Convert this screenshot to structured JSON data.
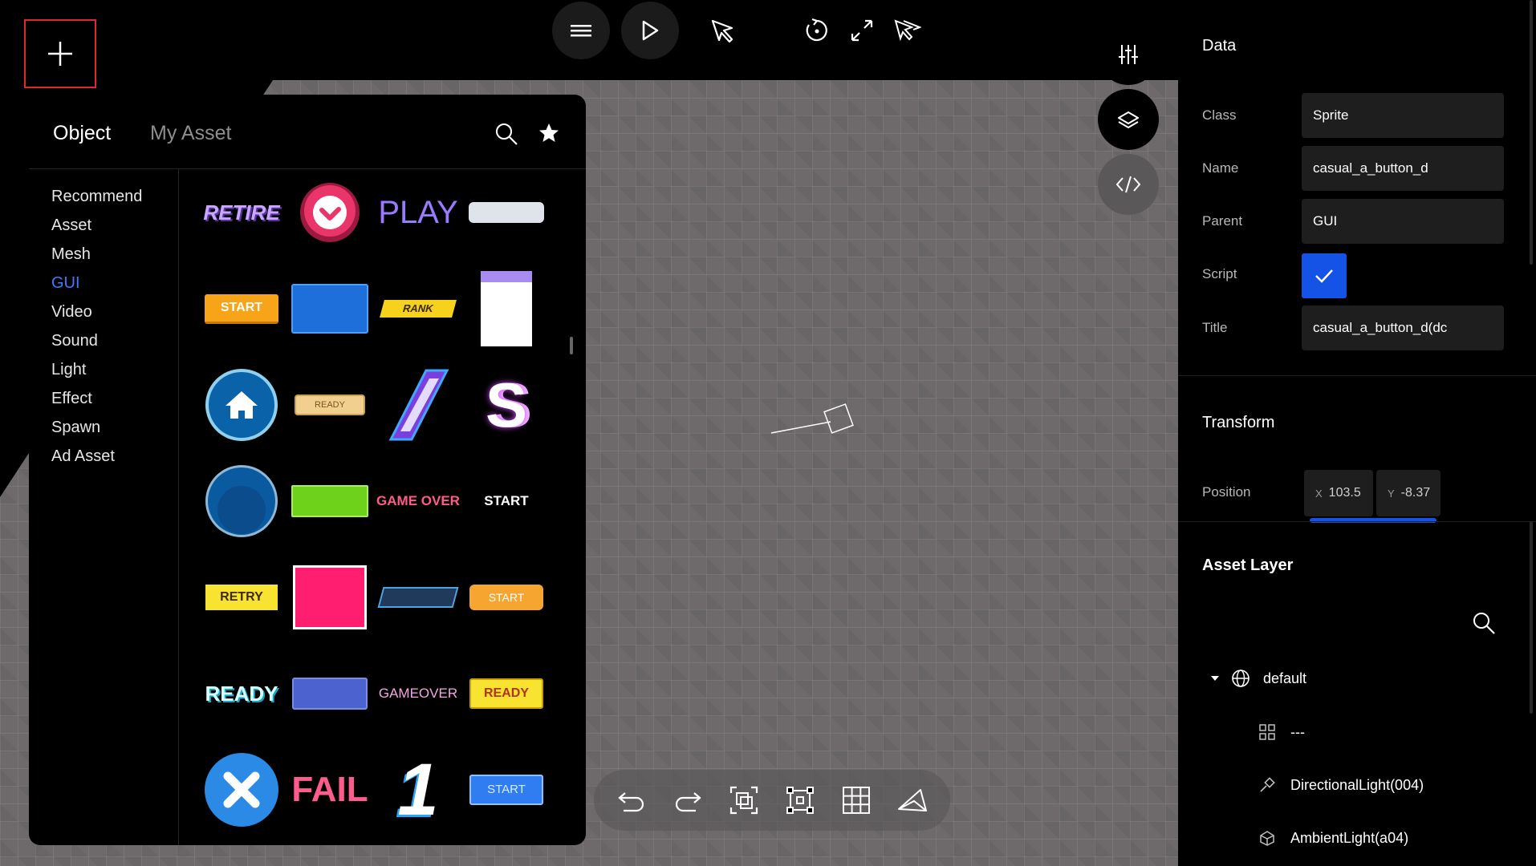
{
  "toolbar": {
    "add_icon": "plus-icon",
    "icons": [
      "menu-icon",
      "play-icon",
      "select-pointer-icon",
      "rotate-icon",
      "expand-icon",
      "multi-select-pointer-icon"
    ]
  },
  "side_tools": [
    "sliders-icon",
    "layers-icon",
    "code-icon"
  ],
  "asset_panel": {
    "tabs": [
      "Object",
      "My Asset"
    ],
    "active_tab": "Object",
    "categories": [
      "Recommend",
      "Asset",
      "Mesh",
      "GUI",
      "Video",
      "Sound",
      "Light",
      "Effect",
      "Spawn",
      "Ad Asset"
    ],
    "active_category": "GUI",
    "items": [
      {
        "text": "RETIRE",
        "style": "retire"
      },
      {
        "text": "",
        "style": "pink-check"
      },
      {
        "text": "PLAY",
        "style": "play"
      },
      {
        "text": "",
        "style": "grey-bar"
      },
      {
        "text": "START",
        "style": "orange-start"
      },
      {
        "text": "",
        "style": "blue-rect"
      },
      {
        "text": "RANK",
        "style": "rank"
      },
      {
        "text": "",
        "style": "white-card"
      },
      {
        "text": "",
        "style": "home-circle"
      },
      {
        "text": "READY",
        "style": "ready-tag"
      },
      {
        "text": "",
        "style": "slash-bar"
      },
      {
        "text": "S",
        "style": "s-logo"
      },
      {
        "text": "",
        "style": "blue-circle"
      },
      {
        "text": "",
        "style": "green-bar"
      },
      {
        "text": "GAME OVER",
        "style": "gameover-pink"
      },
      {
        "text": "START",
        "style": "start-white"
      },
      {
        "text": "RETRY",
        "style": "retry-yellow"
      },
      {
        "text": "",
        "style": "pink-square"
      },
      {
        "text": "",
        "style": "dark-bar"
      },
      {
        "text": "START",
        "style": "orange-start2"
      },
      {
        "text": "READY",
        "style": "ready-cyan"
      },
      {
        "text": "",
        "style": "purple-bar"
      },
      {
        "text": "GAMEOVER",
        "style": "gameover-pink2"
      },
      {
        "text": "READY",
        "style": "ready-yellow"
      },
      {
        "text": "",
        "style": "x-circle"
      },
      {
        "text": "FAIL",
        "style": "fail"
      },
      {
        "text": "1",
        "style": "one"
      },
      {
        "text": "START",
        "style": "start-blue"
      }
    ]
  },
  "bottom_toolbar": [
    "undo-icon",
    "redo-icon",
    "frame-select-icon",
    "transform-box-icon",
    "grid-icon",
    "camera-view-icon"
  ],
  "data_panel": {
    "title": "Data",
    "class_label": "Class",
    "class_value": "Sprite",
    "name_label": "Name",
    "name_value": "casual_a_button_d",
    "parent_label": "Parent",
    "parent_value": "GUI",
    "script_label": "Script",
    "script_checked": true,
    "title_label": "Title",
    "title_value": "casual_a_button_d(dc"
  },
  "transform": {
    "title": "Transform",
    "position_label": "Position",
    "x_axis": "X",
    "x_value": "103.5",
    "y_axis": "Y",
    "y_value": "-8.37"
  },
  "asset_layer": {
    "title": "Asset Layer",
    "root": "default",
    "children": [
      "---",
      "DirectionalLight(004)",
      "AmbientLight(a04)"
    ]
  },
  "colors": {
    "accent": "#1552e6",
    "active_category": "#3b7bff",
    "highlight_border": "#e0282e"
  }
}
